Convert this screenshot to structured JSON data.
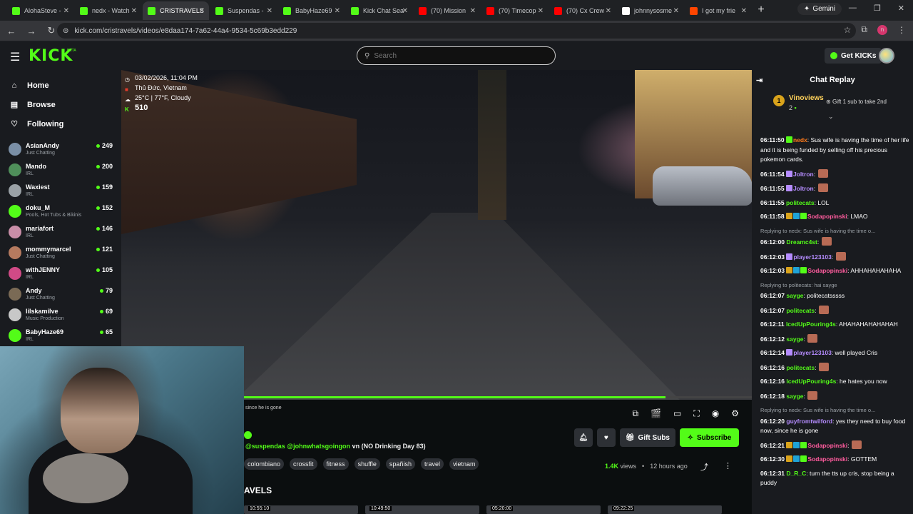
{
  "browser": {
    "tabs": [
      {
        "title": "AlohaSteve -",
        "color": "#53fc18"
      },
      {
        "title": "nedx - Watch",
        "color": "#53fc18"
      },
      {
        "title": "CRISTRAVELS",
        "color": "#53fc18",
        "active": true
      },
      {
        "title": "Suspendas -",
        "color": "#53fc18"
      },
      {
        "title": "BabyHaze69",
        "color": "#53fc18"
      },
      {
        "title": "Kick Chat Sea",
        "color": "#53fc18"
      },
      {
        "title": "(70) Mission",
        "color": "#ff0000"
      },
      {
        "title": "(70) Timecop",
        "color": "#ff0000"
      },
      {
        "title": "(70) Cx Crew",
        "color": "#ff0000"
      },
      {
        "title": "johnnysosme",
        "color": "#ffffff"
      },
      {
        "title": "I got my frie",
        "color": "#ff4500"
      }
    ],
    "gemini_label": "Gemini",
    "url": "kick.com/cristravels/videos/e8daa174-7a62-44a4-9534-5c69b3edd229",
    "profile_initial": "n"
  },
  "site": {
    "logo": "KICK",
    "beta": "BETA",
    "search_placeholder": "Search",
    "get_kicks": "Get KICKs",
    "nav": [
      {
        "label": "Home",
        "icon": "⌂"
      },
      {
        "label": "Browse",
        "icon": "▤"
      },
      {
        "label": "Following",
        "icon": "♡"
      }
    ],
    "following": [
      {
        "name": "AsianAndy",
        "sub": "Just Chatting",
        "count": "249",
        "color": "#7a8fa6"
      },
      {
        "name": "Mando",
        "sub": "IRL",
        "count": "200",
        "color": "#4f8f5a"
      },
      {
        "name": "Waxiest",
        "sub": "IRL",
        "count": "159",
        "color": "#9aa1a6"
      },
      {
        "name": "doku_M",
        "sub": "Pools, Hot Tubs & Bikinis",
        "count": "152",
        "color": "#53fc18"
      },
      {
        "name": "mariafort",
        "sub": "IRL",
        "count": "146",
        "color": "#c98ea8"
      },
      {
        "name": "mommymarcel",
        "sub": "Just Chatting",
        "count": "121",
        "color": "#b57a5f"
      },
      {
        "name": "withJENNY",
        "sub": "IRL",
        "count": "105",
        "color": "#d14a86"
      },
      {
        "name": "Andy",
        "sub": "Just Chatting",
        "count": "79",
        "color": "#7a6a55"
      },
      {
        "name": "lilskamilve",
        "sub": "Music Production",
        "count": "69",
        "color": "#c8c8c8"
      },
      {
        "name": "BabyHaze69",
        "sub": "IRL",
        "count": "65",
        "color": "#53fc18"
      }
    ]
  },
  "video": {
    "date": "03/02/2026, 11:04 PM",
    "location": "Thủ Đức, Vietnam",
    "weather": "25°C | 77°F, Cloudy",
    "viewers": "510",
    "caption": "since he is gone",
    "progress": 0.83
  },
  "info": {
    "mentions": "@suspendas @johnwhatsgoingon",
    "flag": "vn",
    "title_rest": " (NO Drinking Day 83)",
    "tags": [
      "colombiano",
      "crossfit",
      "fitness",
      "shuffle",
      "spañish",
      "travel",
      "vietnam"
    ],
    "gift_subs": "Gift Subs",
    "subscribe": "Subscribe",
    "views": "1.4K",
    "views_label": "views",
    "ago": "12 hours ago",
    "section": "AVELS",
    "thumbs": [
      "10:55:10",
      "10:49:50",
      "05:20:00",
      "09:22:25"
    ]
  },
  "chat": {
    "title": "Chat Replay",
    "pinned_rank": "1",
    "pinned_name": "Vinoviews",
    "pinned_count": "2",
    "pinned_gift": "Gift 1 sub to take 2nd",
    "messages": [
      {
        "time": "06:11:50",
        "user": "nedx",
        "color": "#ff7a1a",
        "text": ": Sus wife is having the time of her life and it is being funded by selling off his precious pokemon cards."
      },
      {
        "time": "06:11:54",
        "user": "Joltron",
        "color": "#b58cff",
        "text": ":",
        "emote": true
      },
      {
        "time": "06:11:55",
        "user": "Joltron",
        "color": "#b58cff",
        "text": ":",
        "emote": true
      },
      {
        "time": "06:11:55",
        "user": "politecats",
        "color": "#53fc18",
        "text": ": LOL"
      },
      {
        "time": "06:11:58",
        "user": "Sodapopinski",
        "color": "#ff5c9e",
        "text": ": LMAO"
      },
      {
        "time": "06:12:00",
        "user": "Dreamc4st",
        "color": "#53fc18",
        "text": ":",
        "emote": true,
        "reply": "Replying to nedx: Sus wife is having the time o..."
      },
      {
        "time": "06:12:03",
        "user": "player123103",
        "color": "#b58cff",
        "text": ":",
        "emote": true
      },
      {
        "time": "06:12:03",
        "user": "Sodapopinski",
        "color": "#ff5c9e",
        "text": ": AHHAHAHAHAHA"
      },
      {
        "time": "06:12:07",
        "user": "sayge",
        "color": "#53fc18",
        "text": ": politecatsssss",
        "reply": "Replying to politecats:    hai sayge"
      },
      {
        "time": "06:12:07",
        "user": "politecats",
        "color": "#53fc18",
        "text": ":",
        "emote": true
      },
      {
        "time": "06:12:11",
        "user": "IcedUpPouring4s",
        "color": "#53fc18",
        "text": ": AHAHAHAHAHAHAH"
      },
      {
        "time": "06:12:12",
        "user": "sayge",
        "color": "#53fc18",
        "text": ":",
        "emote": true
      },
      {
        "time": "06:12:14",
        "user": "player123103",
        "color": "#b58cff",
        "text": ": well played Cris"
      },
      {
        "time": "06:12:16",
        "user": "politecats",
        "color": "#53fc18",
        "text": ":",
        "emote": true
      },
      {
        "time": "06:12:16",
        "user": "IcedUpPouring4s",
        "color": "#53fc18",
        "text": ": he hates you now"
      },
      {
        "time": "06:12:18",
        "user": "sayge",
        "color": "#53fc18",
        "text": ":",
        "emote": true
      },
      {
        "time": "06:12:20",
        "user": "guyfromtwilford",
        "color": "#b58cff",
        "text": ": yes they need to buy food now, since he is gone",
        "reply": "Replying to nedx: Sus wife is having the time o..."
      },
      {
        "time": "06:12:21",
        "user": "Sodapopinski",
        "color": "#ff5c9e",
        "text": ":",
        "emote": true
      },
      {
        "time": "06:12:30",
        "user": "Sodapopinski",
        "color": "#ff5c9e",
        "text": ": GOTTEM"
      },
      {
        "time": "06:12:31",
        "user": "D_R_C",
        "color": "#53fc18",
        "text": ": turn the tts up cris, stop being a puddy"
      }
    ]
  }
}
